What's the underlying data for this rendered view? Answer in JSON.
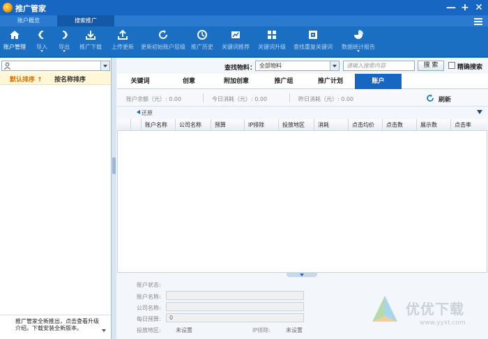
{
  "window": {
    "title": "推广管家",
    "menu_icon": "hamburger-menu-icon"
  },
  "top_tabs": [
    {
      "label": "账户概览",
      "active": false
    },
    {
      "label": "搜索推广",
      "active": true
    }
  ],
  "toolbar": [
    {
      "label": "账户管理",
      "icon": "home-icon",
      "active": true
    },
    {
      "label": "导入",
      "icon": "undo-arrow-icon",
      "dropdown": true
    },
    {
      "label": "导出",
      "icon": "redo-arrow-icon",
      "dropdown": true
    },
    {
      "label": "推广下载",
      "icon": "download-icon"
    },
    {
      "label": "上传更新",
      "icon": "upload-icon"
    },
    {
      "label": "更新初始账户层级",
      "icon": "refresh-icon"
    },
    {
      "label": "推广历史",
      "icon": "clock-icon"
    },
    {
      "label": "关键词推荐",
      "icon": "chart-icon"
    },
    {
      "label": "关键词升级",
      "icon": "grid-icon"
    },
    {
      "label": "查找重复关键词",
      "icon": "find-duplicate-icon"
    },
    {
      "label": "数据统计报告",
      "icon": "pie-chart-icon",
      "dropdown": true
    }
  ],
  "left_panel": {
    "search_value": "",
    "sort_default": "默认排序",
    "sort_default_arrow": "↑",
    "sort_by_name": "按名称排序",
    "footer_text": "推广管家全新推出，点击查看升级介绍。下载安装全新版本。"
  },
  "search": {
    "find_label": "查找物料：",
    "scope_value": "全部物料",
    "keyword_placeholder": "请输入搜索内容",
    "search_button": "搜 索",
    "exact_label": "精确搜索",
    "exact_checked": false
  },
  "sub_tabs": [
    {
      "label": "关键词",
      "active": false
    },
    {
      "label": "创意",
      "active": false
    },
    {
      "label": "附加创意",
      "active": false
    },
    {
      "label": "推广组",
      "active": false
    },
    {
      "label": "推广计划",
      "active": false
    },
    {
      "label": "账户",
      "active": true
    }
  ],
  "stats": {
    "balance": "账户余额（元）: 0.00",
    "today": "今日消耗（元）: 0.00",
    "yesterday": "昨日消耗（元）: 0.00",
    "refresh": "刷新"
  },
  "restore_label": "还原",
  "table": {
    "columns": [
      "账户名称",
      "公司名称",
      "预算",
      "IP排除",
      "投放地区",
      "消耗",
      "点击均价",
      "点击数",
      "展示数",
      "点击率"
    ],
    "rows": []
  },
  "detail": {
    "status_label": "账户状态:",
    "name_label": "账户名称:",
    "company_label": "公司名称:",
    "budget_label": "每日预算:",
    "budget_value": "0",
    "region_label": "投放地区:",
    "region_value": "未设置",
    "ip_label": "IP排除:",
    "ip_value": "未设置"
  },
  "watermark": {
    "text": "优优下载",
    "url": "www.yyxt.com"
  }
}
